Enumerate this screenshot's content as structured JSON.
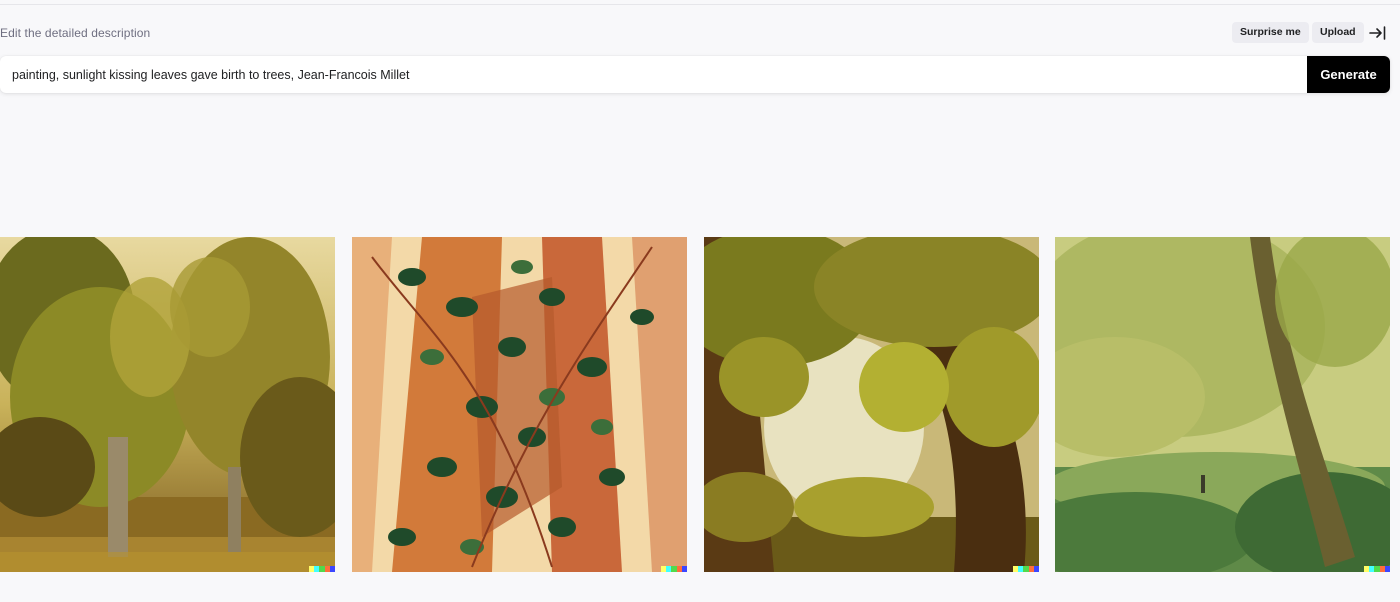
{
  "editor": {
    "label": "Edit the detailed description",
    "surprise_label": "Surprise me",
    "upload_label": "Upload",
    "prompt_value": "painting, sunlight kissing leaves gave birth to trees, Jean-Francois Millet",
    "generate_label": "Generate"
  },
  "icons": {
    "collapse": "collapse-sidebar-icon"
  },
  "colors": {
    "page_bg": "#f8f8fa",
    "chip_bg": "#ececf1",
    "generate_bg": "#000000",
    "signature": [
      "#ffff66",
      "#42ffff",
      "#51da4c",
      "#ff6e3c",
      "#3c46ff"
    ]
  },
  "results": [
    {
      "name": "forest-painting-1"
    },
    {
      "name": "ivy-trees-painting-2"
    },
    {
      "name": "tree-arch-painting-3"
    },
    {
      "name": "meadow-trees-painting-4"
    }
  ]
}
